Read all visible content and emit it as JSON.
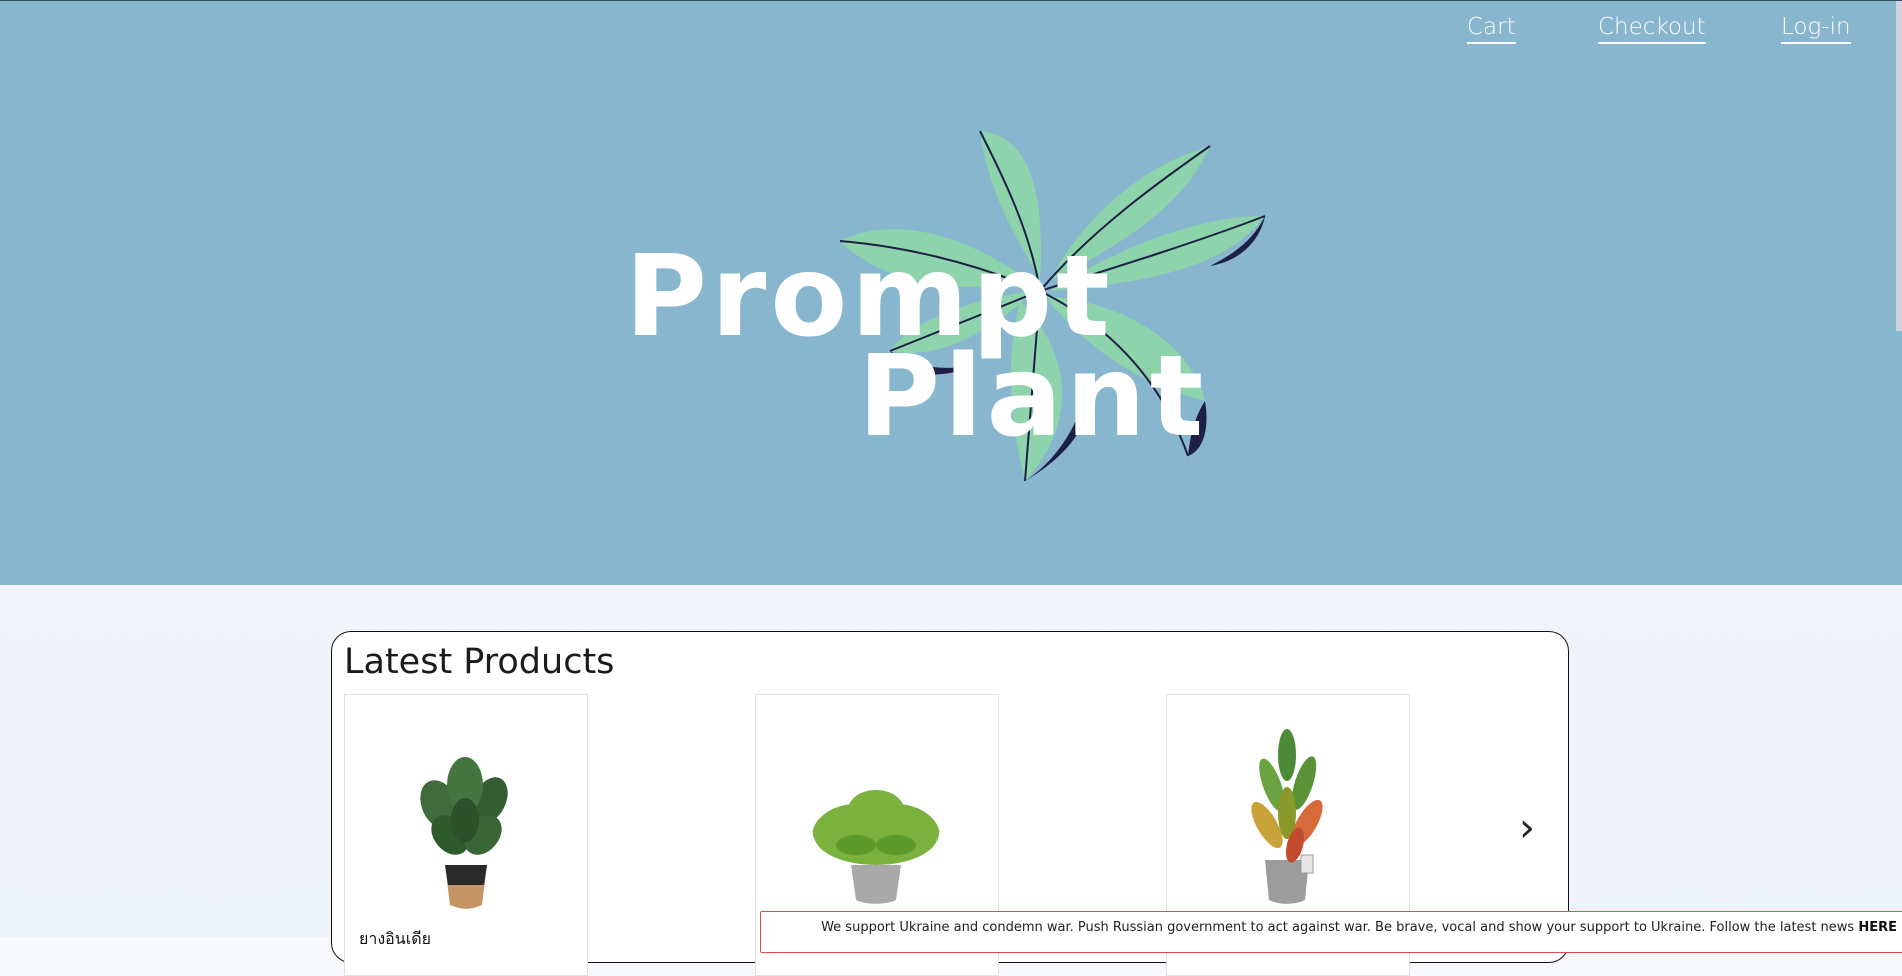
{
  "nav": {
    "cart_label": "Cart",
    "checkout_label": "Checkout",
    "login_label": "Log-in"
  },
  "hero": {
    "brand_line1": "Prompt",
    "brand_line2": "Plant",
    "colors": {
      "background": "#88b6cf",
      "leaf_light": "#8dd4ac",
      "leaf_dark": "#1d1f45"
    }
  },
  "products": {
    "title": "Latest Products",
    "items": [
      {
        "name": "ยางอินเดีย",
        "icon": "rubber-plant"
      },
      {
        "name": "",
        "icon": "boston-fern"
      },
      {
        "name": "",
        "icon": "croton-plant"
      }
    ]
  },
  "banner": {
    "text": "We support Ukraine and condemn war. Push Russian government to act against war. Be brave, vocal and show your support to Ukraine. Follow the latest news",
    "link": "HERE"
  }
}
